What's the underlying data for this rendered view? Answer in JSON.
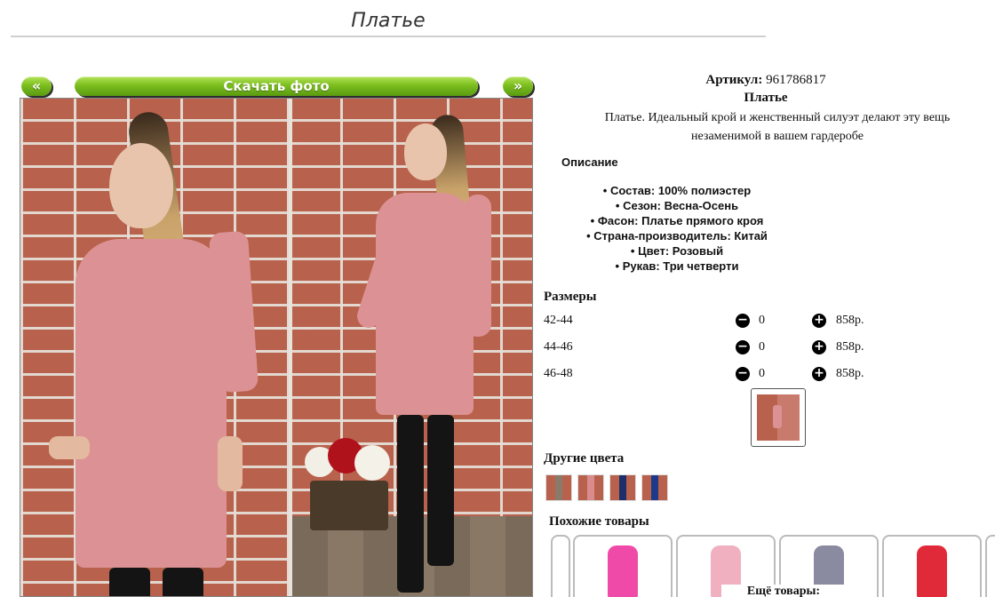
{
  "page": {
    "title": "Платье"
  },
  "gallery": {
    "prev_label": "«",
    "download_label": "Скачать фото",
    "next_label": "»"
  },
  "product": {
    "article_label": "Артикул:",
    "article_value": "961786817",
    "name": "Платье",
    "summary": "Платье. Идеальный крой и женственный силуэт делают эту вещь незаменимой в вашем гардеробе",
    "description_title": "Описание",
    "specs": [
      "Состав: 100% полиэстер",
      "Сезон: Весна-Осень",
      "Фасон: Платье прямого кроя",
      "Страна-производитель: Китай",
      "Цвет: Розовый",
      "Рукав: Три четверти"
    ]
  },
  "sizes": {
    "title": "Размеры",
    "minus_icon": "minus-circle-icon",
    "plus_icon": "plus-circle-icon",
    "rows": [
      {
        "size": "42-44",
        "qty": "0",
        "price": "858р."
      },
      {
        "size": "44-46",
        "qty": "0",
        "price": "858р."
      },
      {
        "size": "46-48",
        "qty": "0",
        "price": "858р."
      }
    ]
  },
  "other_colors": {
    "title": "Другие цвета",
    "swatches": [
      "#8a7a6a",
      "#d98c8e",
      "#1d2f6b",
      "#1d3a8a"
    ]
  },
  "similar": {
    "title": "Похожие товары",
    "items": [
      "#f04aa8",
      "#f0b0c0",
      "#8a8aa0",
      "#e02a3a"
    ],
    "more_label": "Ещё товары:"
  },
  "colors": {
    "accent_green": "#7cbf1e",
    "dress_pink": "#dc9294",
    "brick": "#b8614c"
  }
}
